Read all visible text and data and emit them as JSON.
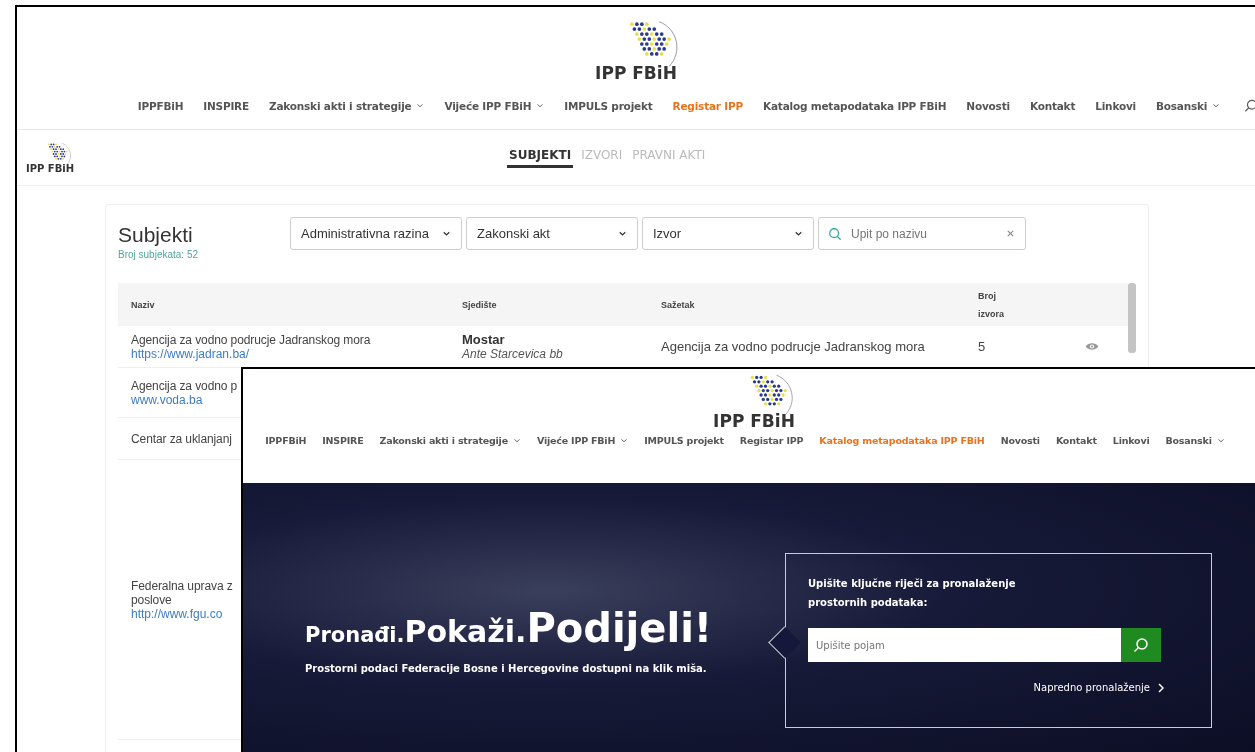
{
  "back_page": {
    "logo": "IPP FBiH",
    "nav": [
      {
        "label": "IPPFBiH",
        "dropdown": false,
        "selected": false
      },
      {
        "label": "INSPIRE",
        "dropdown": false,
        "selected": false
      },
      {
        "label": "Zakonski akti i strategije",
        "dropdown": true,
        "selected": false
      },
      {
        "label": "Vijeće IPP FBiH",
        "dropdown": true,
        "selected": false
      },
      {
        "label": "IMPULS projekt",
        "dropdown": false,
        "selected": false
      },
      {
        "label": "Registar IPP",
        "dropdown": false,
        "selected": true
      },
      {
        "label": "Katalog metapodataka IPP FBiH",
        "dropdown": false,
        "selected": false
      },
      {
        "label": "Novosti",
        "dropdown": false,
        "selected": false
      },
      {
        "label": "Kontakt",
        "dropdown": false,
        "selected": false
      },
      {
        "label": "Linkovi",
        "dropdown": false,
        "selected": false
      },
      {
        "label": "Bosanski",
        "dropdown": true,
        "selected": false
      }
    ],
    "sub_logo": "IPP FBiH",
    "tabs": [
      {
        "label": "SUBJEKTI",
        "selected": true
      },
      {
        "label": "IZVORI",
        "selected": false
      },
      {
        "label": "PRAVNI AKTI",
        "selected": false
      }
    ],
    "card": {
      "title": "Subjekti",
      "count": "Broj subjekata: 52",
      "filters": [
        "Administrativna razina",
        "Zakonski akt",
        "Izvor"
      ],
      "search": {
        "placeholder": "Upit po nazivu"
      },
      "table": {
        "columns": [
          "Naziv",
          "Sjedište",
          "Sažetak",
          "Broj izvora"
        ],
        "rows": [
          {
            "name": "Agencija za vodno podrucje Jadranskog mora",
            "link": "https://www.jadran.ba/",
            "city": "Mostar",
            "address": "Ante Starcevica bb",
            "summary": "Agencija za vodno podrucje Jadranskog mora",
            "count": "5"
          },
          {
            "name": "Agencija za vodno p",
            "link": "www.voda.ba"
          },
          {
            "name": "Centar za uklanjanj"
          },
          {
            "name": "Federalna uprava z",
            "name_2": "poslove",
            "link": "http://www.fgu.co"
          }
        ]
      }
    }
  },
  "front_page": {
    "logo": "IPP FBiH",
    "nav": [
      {
        "label": "IPPFBiH",
        "dropdown": false,
        "selected": false
      },
      {
        "label": "INSPIRE",
        "dropdown": false,
        "selected": false
      },
      {
        "label": "Zakonski akti i strategije",
        "dropdown": true,
        "selected": false
      },
      {
        "label": "Vijeće IPP FBiH",
        "dropdown": true,
        "selected": false
      },
      {
        "label": "IMPULS projekt",
        "dropdown": false,
        "selected": false
      },
      {
        "label": "Registar IPP",
        "dropdown": false,
        "selected": false
      },
      {
        "label": "Katalog metapodataka IPP FBiH",
        "dropdown": false,
        "selected": true
      },
      {
        "label": "Novosti",
        "dropdown": false,
        "selected": false
      },
      {
        "label": "Kontakt",
        "dropdown": false,
        "selected": false
      },
      {
        "label": "Linkovi",
        "dropdown": false,
        "selected": false
      },
      {
        "label": "Bosanski",
        "dropdown": true,
        "selected": false
      }
    ],
    "hero": {
      "title_parts": [
        "Pronađi.",
        "Pokaži.",
        "Podijeli!"
      ],
      "subtitle": "Prostorni podaci Federacije Bosne i Hercegovine dostupni na klik miša.",
      "search_label": "Upišite ključne riječi za pronalaženje prostornih podataka:",
      "search": {
        "placeholder": "Upišite pojam"
      },
      "advanced_link": "Napredno pronalaženje"
    }
  }
}
